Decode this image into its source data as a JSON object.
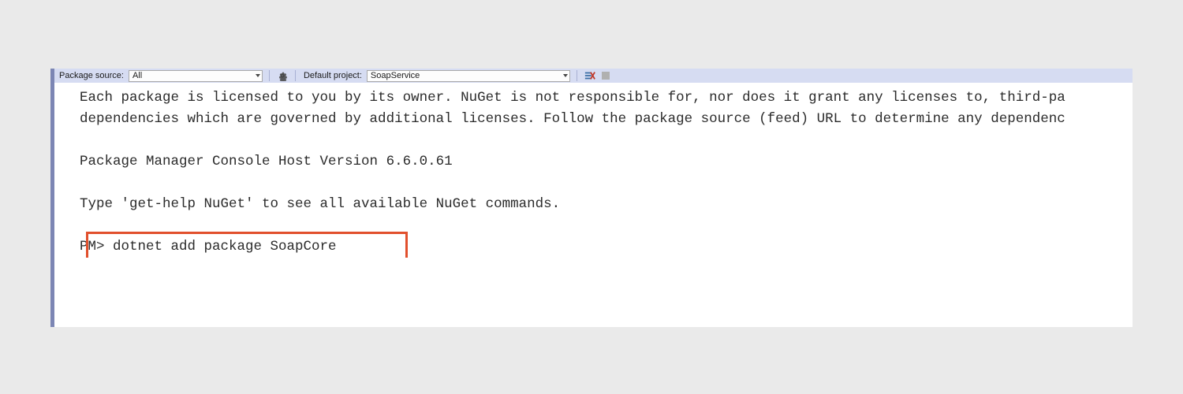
{
  "toolbar": {
    "package_source_label": "Package source:",
    "package_source_value": "All",
    "default_project_label": "Default project:",
    "default_project_value": "SoapService"
  },
  "console": {
    "line1": "Each package is licensed to you by its owner. NuGet is not responsible for, nor does it grant any licenses to, third-pa",
    "line2": "dependencies which are governed by additional licenses. Follow the package source (feed) URL to determine any dependenc",
    "blank": "",
    "line3": "Package Manager Console Host Version 6.6.0.61",
    "line4": "Type 'get-help NuGet' to see all available NuGet commands.",
    "prompt": "PM> ",
    "command": "dotnet add package SoapCore"
  }
}
